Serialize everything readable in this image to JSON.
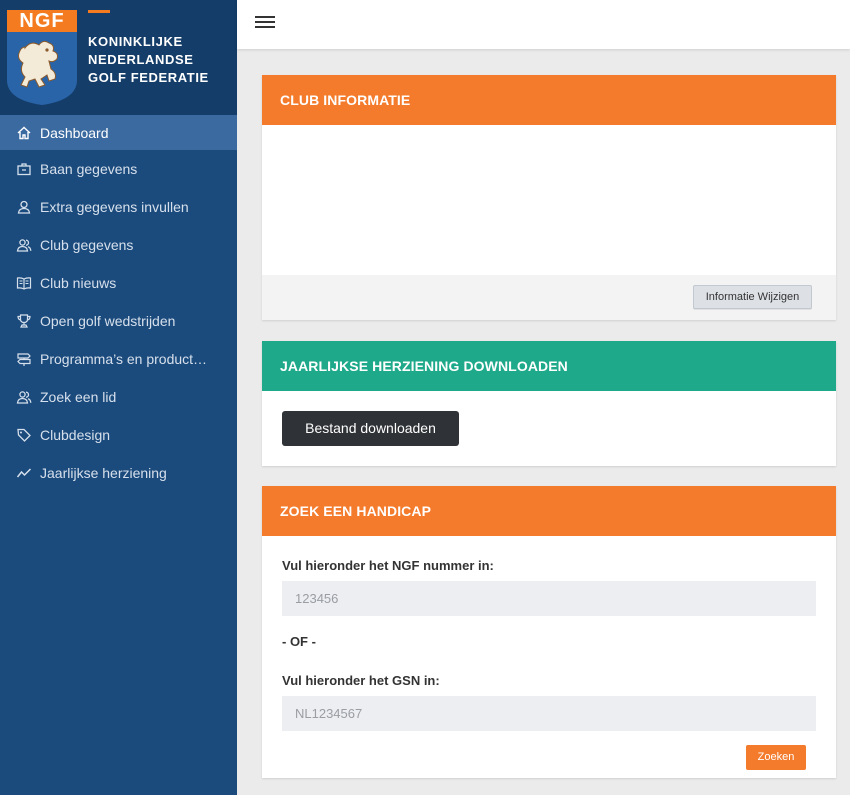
{
  "brand": {
    "logo_text": "NGF",
    "name_lines": [
      "KONINKLIJKE",
      "NEDERLANDSE",
      "GOLF FEDERATIE"
    ]
  },
  "sidebar": {
    "items": [
      {
        "label": "Dashboard",
        "icon": "home-icon"
      },
      {
        "label": "Baan gegevens",
        "icon": "briefcase-icon"
      },
      {
        "label": "Extra gegevens invullen",
        "icon": "user-icon"
      },
      {
        "label": "Club gegevens",
        "icon": "users-icon"
      },
      {
        "label": "Club nieuws",
        "icon": "book-icon"
      },
      {
        "label": "Open golf wedstrijden",
        "icon": "trophy-icon"
      },
      {
        "label": "Programma’s en product…",
        "icon": "signpost-icon"
      },
      {
        "label": "Zoek een lid",
        "icon": "users-icon"
      },
      {
        "label": "Clubdesign",
        "icon": "tag-icon"
      },
      {
        "label": "Jaarlijkse herziening",
        "icon": "chart-line-icon"
      }
    ]
  },
  "panels": {
    "club": {
      "title": "CLUB INFORMATIE",
      "button": "Informatie Wijzigen"
    },
    "download": {
      "title": "JAARLIJKSE HERZIENING DOWNLOADEN",
      "button": "Bestand downloaden"
    },
    "handicap": {
      "title": "ZOEK EEN HANDICAP",
      "ngf_label": "Vul hieronder het NGF nummer in:",
      "ngf_placeholder": "123456",
      "or_text": "- OF -",
      "gsn_label": "Vul hieronder het GSN in:",
      "gsn_placeholder": "NL1234567",
      "search_button": "Zoeken"
    }
  },
  "colors": {
    "sidebar": "#1b4a7c",
    "sidebar_active": "#3b6aa0",
    "accent_orange": "#f47b2b",
    "accent_teal": "#1fa98b"
  }
}
